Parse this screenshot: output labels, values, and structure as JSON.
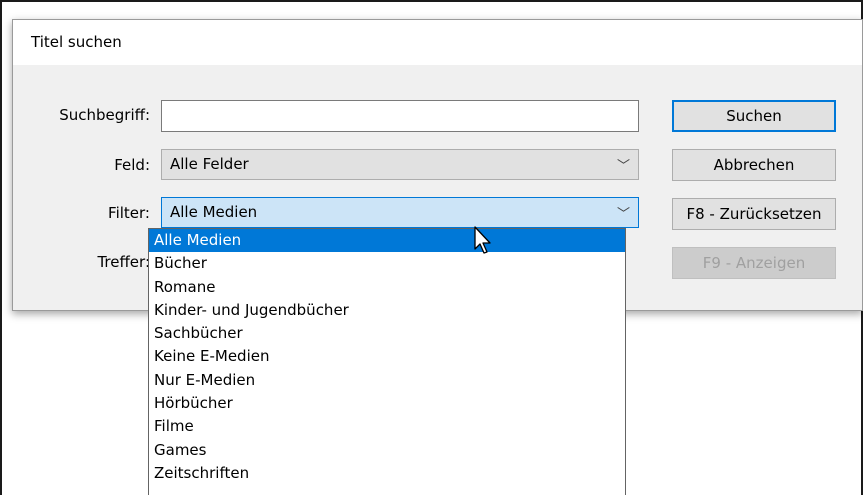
{
  "dialog": {
    "title": "Titel suchen",
    "labels": {
      "search_term": "Suchbegriff:",
      "field": "Feld:",
      "filter": "Filter:",
      "hits": "Treffer:"
    },
    "search_input": {
      "value": ""
    },
    "field_combo": {
      "value": "Alle Felder"
    },
    "filter_combo": {
      "value": "Alle Medien",
      "options": [
        "Alle Medien",
        "Bücher",
        "Romane",
        "Kinder- und Jugendbücher",
        "Sachbücher",
        "Keine E-Medien",
        "Nur E-Medien",
        "Hörbücher",
        "Filme",
        "Games",
        "Zeitschriften"
      ],
      "highlighted": "Alle Medien"
    },
    "buttons": {
      "search": "Suchen",
      "cancel": "Abbrechen",
      "reset": "F8 - Zurücksetzen",
      "show": "F9 - Anzeigen"
    }
  },
  "icons": {
    "chevron": "chevron-down-icon",
    "cursor": "mouse-cursor-icon"
  }
}
